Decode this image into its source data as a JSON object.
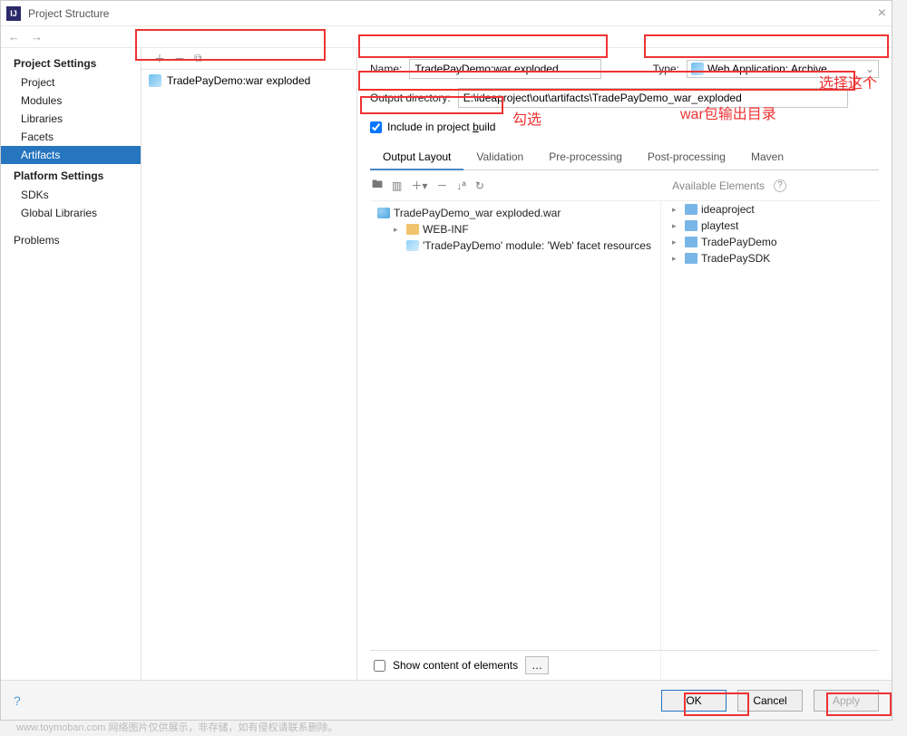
{
  "window": {
    "title": "Project Structure"
  },
  "sidebar": {
    "sections": [
      {
        "heading": "Project Settings",
        "items": [
          "Project",
          "Modules",
          "Libraries",
          "Facets",
          "Artifacts"
        ],
        "selected": 4
      },
      {
        "heading": "Platform Settings",
        "items": [
          "SDKs",
          "Global Libraries"
        ]
      },
      {
        "heading": "",
        "items": [
          "Problems"
        ]
      }
    ]
  },
  "artifact_list": {
    "items": [
      "TradePayDemo:war exploded"
    ]
  },
  "form": {
    "name_label": "Name:",
    "name_value": "TradePayDemo:war exploded",
    "type_label": "Type:",
    "type_value": "Web Application: Archive",
    "output_label": "Output directory:",
    "output_value": "E:\\ideaproject\\out\\artifacts\\TradePayDemo_war_exploded",
    "include_label": "Include in project build",
    "include_checked": true
  },
  "tabs": [
    "Output Layout",
    "Validation",
    "Pre-processing",
    "Post-processing",
    "Maven"
  ],
  "tabs_active": 0,
  "available_header": "Available Elements",
  "output_tree": [
    {
      "level": 0,
      "icon": "war",
      "label": "TradePayDemo_war exploded.war"
    },
    {
      "level": 1,
      "icon": "folder",
      "label": "WEB-INF",
      "expandable": true
    },
    {
      "level": 1,
      "icon": "facet",
      "label": "'TradePayDemo' module: 'Web' facet resources"
    }
  ],
  "available_tree": [
    {
      "icon": "pfolder",
      "label": "ideaproject",
      "expandable": true
    },
    {
      "icon": "pfolder",
      "label": "playtest",
      "expandable": true
    },
    {
      "icon": "pfolder",
      "label": "TradePayDemo",
      "expandable": true
    },
    {
      "icon": "pfolder",
      "label": "TradePaySDK",
      "expandable": true
    }
  ],
  "show_content_label": "Show content of elements",
  "footer": {
    "ok": "OK",
    "cancel": "Cancel",
    "apply": "Apply"
  },
  "annotations": {
    "select_this": "选择这个",
    "check": "勾选",
    "war_output": "war包输出目录"
  },
  "watermark": "www.toymoban.com 网络图片仅供展示，非存储，如有侵权请联系删除。"
}
